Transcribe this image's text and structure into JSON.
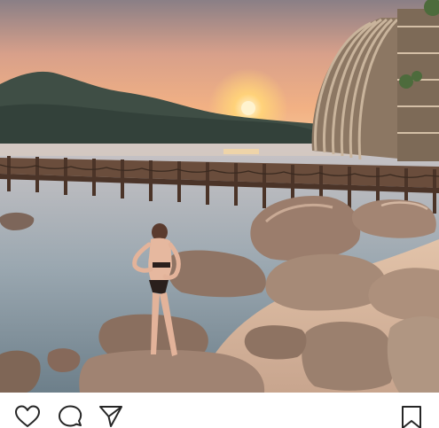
{
  "post": {
    "image_description_icons": {
      "like": "heart-icon",
      "comment": "comment-icon",
      "share": "paper-plane-icon",
      "save": "bookmark-icon"
    }
  },
  "colors": {
    "icon_stroke": "#262626",
    "background": "#ffffff"
  }
}
